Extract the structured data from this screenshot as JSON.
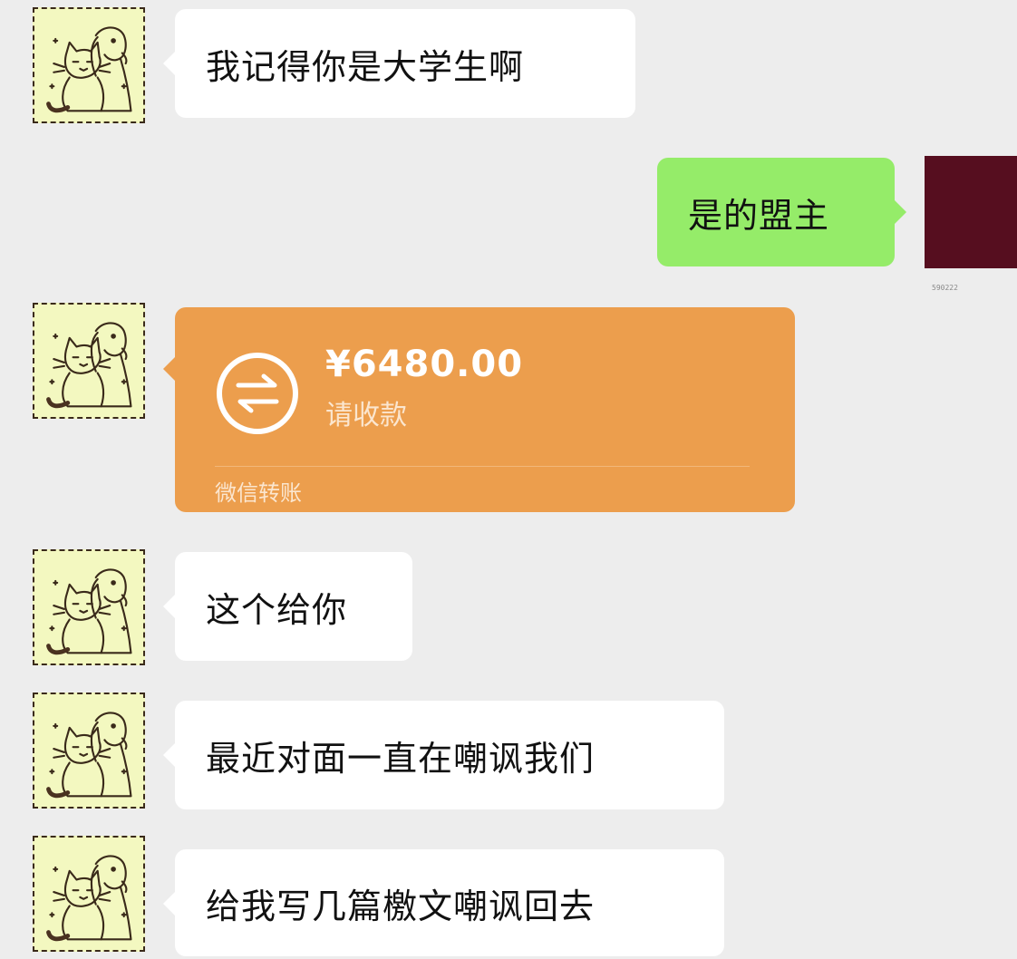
{
  "messages": [
    {
      "sender": "other",
      "type": "text",
      "text": "我记得你是大学生啊"
    },
    {
      "sender": "self",
      "type": "text",
      "text": "是的盟主"
    },
    {
      "sender": "other",
      "type": "transfer",
      "amount": "¥6480.00",
      "status": "请收款",
      "footer": "微信转账"
    },
    {
      "sender": "other",
      "type": "text",
      "text": "这个给你"
    },
    {
      "sender": "other",
      "type": "text",
      "text": "最近对面一直在嘲讽我们"
    },
    {
      "sender": "other",
      "type": "text",
      "text": "给我写几篇檄文嘲讽回去"
    }
  ],
  "self_avatar": {
    "caption": "590222",
    "color": "#560e1f"
  },
  "other_avatar": {
    "icon": "cat-dog-illustration-icon",
    "background": "#f3f8c0"
  },
  "colors": {
    "background": "#ededed",
    "bubble_other": "#ffffff",
    "bubble_self": "#95ec69",
    "transfer": "#ec9e4d"
  }
}
